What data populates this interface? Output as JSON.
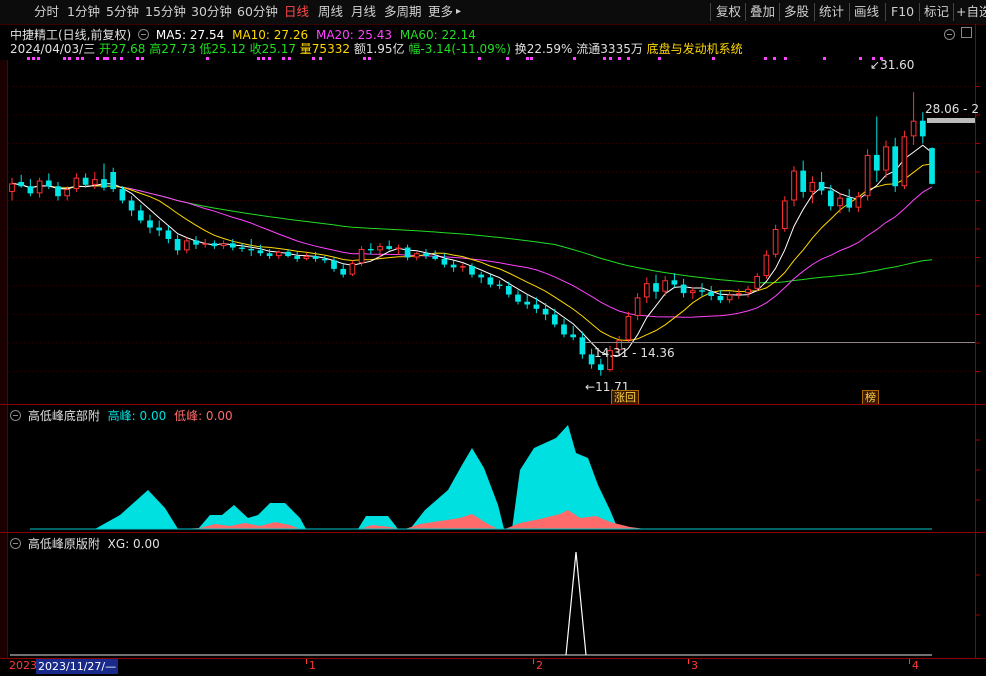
{
  "toolbar": {
    "periods": [
      "分时",
      "1分钟",
      "5分钟",
      "15分钟",
      "30分钟",
      "60分钟",
      "日线",
      "周线",
      "月线",
      "多周期",
      "更多"
    ],
    "active_period": "日线",
    "more_arrow": "▸",
    "right_buttons": [
      "复权",
      "叠加",
      "多股",
      "统计",
      "画线",
      "F10",
      "标记",
      "+自选"
    ]
  },
  "header": {
    "title": "中捷精工(日线,前复权)",
    "ma5": "MA5: 27.54",
    "ma10": "MA10: 27.26",
    "ma20": "MA20: 25.43",
    "ma60": "MA60: 22.14",
    "date": "2024/04/03/三",
    "open": "开27.68",
    "high": "高27.73",
    "low": "低25.12",
    "close": "收25.17",
    "volume": "量75332",
    "amount": "额1.95亿",
    "change": "幅-3.14(-11.09%)",
    "turnover": "换22.59%",
    "float": "流通3335万",
    "system_name": "底盘与发动机系统"
  },
  "price_chart": {
    "labels": {
      "high_mark": "31.60",
      "low_mark": "11.71",
      "range_mark": "14.31 - 14.36",
      "right_price": "28.06 - 2"
    },
    "badges": [
      "涨回",
      "榜"
    ],
    "colors": {
      "up": "#ff3232",
      "down": "#00e5e5",
      "ma5": "#ffffff",
      "ma10": "#ffd800",
      "ma20": "#ff44ff",
      "ma60": "#22dd22"
    }
  },
  "indicator1": {
    "name": "高低峰底部附",
    "high_label": "高峰: 0.00",
    "low_label": "低峰: 0.00"
  },
  "indicator2": {
    "name": "高低峰原版附",
    "xg_label": "XG: 0.00"
  },
  "time_axis": {
    "year": "2023",
    "cursor_date": "2023/11/27/—",
    "months": [
      "1",
      "2",
      "3",
      "4"
    ]
  },
  "chart_data": {
    "type": "candlestick",
    "title": "中捷精工(日线,前复权)",
    "ylim": [
      10,
      34
    ],
    "note_high": 31.6,
    "note_low": 11.71,
    "candles": [
      {
        "o": 24.6,
        "h": 25.6,
        "l": 24.0,
        "c": 25.2
      },
      {
        "o": 25.3,
        "h": 25.8,
        "l": 24.9,
        "c": 25.0
      },
      {
        "o": 25.0,
        "h": 25.5,
        "l": 24.3,
        "c": 24.5
      },
      {
        "o": 24.5,
        "h": 25.6,
        "l": 24.2,
        "c": 25.4
      },
      {
        "o": 25.4,
        "h": 25.9,
        "l": 24.8,
        "c": 25.0
      },
      {
        "o": 25.0,
        "h": 25.3,
        "l": 24.0,
        "c": 24.3
      },
      {
        "o": 24.3,
        "h": 25.0,
        "l": 24.0,
        "c": 24.8
      },
      {
        "o": 24.8,
        "h": 25.9,
        "l": 24.6,
        "c": 25.6
      },
      {
        "o": 25.6,
        "h": 25.9,
        "l": 24.9,
        "c": 25.1
      },
      {
        "o": 25.1,
        "h": 26.0,
        "l": 24.8,
        "c": 25.5
      },
      {
        "o": 25.5,
        "h": 26.6,
        "l": 24.7,
        "c": 24.9
      },
      {
        "o": 26.0,
        "h": 26.3,
        "l": 24.6,
        "c": 24.8
      },
      {
        "o": 24.8,
        "h": 25.0,
        "l": 23.8,
        "c": 24.0
      },
      {
        "o": 24.0,
        "h": 24.3,
        "l": 22.9,
        "c": 23.3
      },
      {
        "o": 23.3,
        "h": 23.7,
        "l": 22.4,
        "c": 22.6
      },
      {
        "o": 22.6,
        "h": 23.0,
        "l": 21.7,
        "c": 22.1
      },
      {
        "o": 22.1,
        "h": 22.6,
        "l": 21.5,
        "c": 21.9
      },
      {
        "o": 21.9,
        "h": 22.2,
        "l": 21.0,
        "c": 21.3
      },
      {
        "o": 21.3,
        "h": 21.6,
        "l": 20.2,
        "c": 20.5
      },
      {
        "o": 20.5,
        "h": 21.4,
        "l": 20.3,
        "c": 21.2
      },
      {
        "o": 21.2,
        "h": 21.5,
        "l": 20.6,
        "c": 20.9
      },
      {
        "o": 20.9,
        "h": 21.3,
        "l": 20.7,
        "c": 21.0
      },
      {
        "o": 21.0,
        "h": 21.2,
        "l": 20.6,
        "c": 20.8
      },
      {
        "o": 20.8,
        "h": 21.2,
        "l": 20.6,
        "c": 21.0
      },
      {
        "o": 21.0,
        "h": 21.3,
        "l": 20.5,
        "c": 20.7
      },
      {
        "o": 20.7,
        "h": 21.0,
        "l": 20.4,
        "c": 20.6
      },
      {
        "o": 20.6,
        "h": 21.3,
        "l": 20.1,
        "c": 20.5
      },
      {
        "o": 20.5,
        "h": 20.9,
        "l": 20.1,
        "c": 20.3
      },
      {
        "o": 20.3,
        "h": 20.6,
        "l": 19.9,
        "c": 20.1
      },
      {
        "o": 20.1,
        "h": 20.5,
        "l": 19.9,
        "c": 20.4
      },
      {
        "o": 20.4,
        "h": 20.6,
        "l": 20.0,
        "c": 20.1
      },
      {
        "o": 20.1,
        "h": 20.4,
        "l": 19.7,
        "c": 19.9
      },
      {
        "o": 19.9,
        "h": 20.3,
        "l": 19.8,
        "c": 20.1
      },
      {
        "o": 20.1,
        "h": 20.4,
        "l": 19.7,
        "c": 19.9
      },
      {
        "o": 19.9,
        "h": 20.1,
        "l": 19.6,
        "c": 19.8
      },
      {
        "o": 19.8,
        "h": 20.0,
        "l": 19.0,
        "c": 19.2
      },
      {
        "o": 19.2,
        "h": 19.5,
        "l": 18.6,
        "c": 18.8
      },
      {
        "o": 18.8,
        "h": 19.8,
        "l": 18.7,
        "c": 19.6
      },
      {
        "o": 19.6,
        "h": 20.8,
        "l": 19.4,
        "c": 20.6
      },
      {
        "o": 20.6,
        "h": 21.0,
        "l": 20.2,
        "c": 20.5
      },
      {
        "o": 20.5,
        "h": 21.0,
        "l": 20.0,
        "c": 20.8
      },
      {
        "o": 20.8,
        "h": 21.2,
        "l": 20.5,
        "c": 20.6
      },
      {
        "o": 20.6,
        "h": 20.9,
        "l": 20.2,
        "c": 20.7
      },
      {
        "o": 20.7,
        "h": 20.9,
        "l": 19.8,
        "c": 20.0
      },
      {
        "o": 20.0,
        "h": 20.4,
        "l": 19.8,
        "c": 20.3
      },
      {
        "o": 20.3,
        "h": 20.6,
        "l": 19.9,
        "c": 20.1
      },
      {
        "o": 20.1,
        "h": 20.5,
        "l": 19.8,
        "c": 19.9
      },
      {
        "o": 19.9,
        "h": 20.3,
        "l": 19.3,
        "c": 19.5
      },
      {
        "o": 19.5,
        "h": 19.8,
        "l": 19.0,
        "c": 19.3
      },
      {
        "o": 19.3,
        "h": 19.6,
        "l": 19.0,
        "c": 19.4
      },
      {
        "o": 19.4,
        "h": 19.6,
        "l": 18.6,
        "c": 18.8
      },
      {
        "o": 18.8,
        "h": 19.0,
        "l": 18.2,
        "c": 18.6
      },
      {
        "o": 18.6,
        "h": 18.8,
        "l": 17.9,
        "c": 18.1
      },
      {
        "o": 18.1,
        "h": 18.4,
        "l": 17.8,
        "c": 18.0
      },
      {
        "o": 18.0,
        "h": 18.3,
        "l": 17.2,
        "c": 17.4
      },
      {
        "o": 17.4,
        "h": 17.7,
        "l": 16.7,
        "c": 16.9
      },
      {
        "o": 16.9,
        "h": 17.4,
        "l": 16.4,
        "c": 16.7
      },
      {
        "o": 16.7,
        "h": 17.2,
        "l": 16.1,
        "c": 16.4
      },
      {
        "o": 16.4,
        "h": 16.8,
        "l": 15.6,
        "c": 16.0
      },
      {
        "o": 16.0,
        "h": 16.4,
        "l": 15.1,
        "c": 15.3
      },
      {
        "o": 15.3,
        "h": 15.7,
        "l": 14.4,
        "c": 14.6
      },
      {
        "o": 14.6,
        "h": 15.2,
        "l": 14.2,
        "c": 14.4
      },
      {
        "o": 14.4,
        "h": 14.8,
        "l": 12.9,
        "c": 13.2
      },
      {
        "o": 13.2,
        "h": 13.6,
        "l": 12.2,
        "c": 12.5
      },
      {
        "o": 12.5,
        "h": 12.9,
        "l": 11.71,
        "c": 12.1
      },
      {
        "o": 12.1,
        "h": 13.8,
        "l": 12.0,
        "c": 13.5
      },
      {
        "o": 13.5,
        "h": 14.5,
        "l": 13.3,
        "c": 14.2
      },
      {
        "o": 14.2,
        "h": 16.2,
        "l": 14.0,
        "c": 15.9
      },
      {
        "o": 15.9,
        "h": 17.5,
        "l": 15.6,
        "c": 17.2
      },
      {
        "o": 17.2,
        "h": 18.6,
        "l": 16.8,
        "c": 18.2
      },
      {
        "o": 18.2,
        "h": 18.8,
        "l": 17.1,
        "c": 17.6
      },
      {
        "o": 17.6,
        "h": 18.7,
        "l": 17.3,
        "c": 18.4
      },
      {
        "o": 18.4,
        "h": 18.9,
        "l": 17.9,
        "c": 18.1
      },
      {
        "o": 18.1,
        "h": 18.5,
        "l": 17.2,
        "c": 17.5
      },
      {
        "o": 17.5,
        "h": 17.9,
        "l": 17.1,
        "c": 17.7
      },
      {
        "o": 17.7,
        "h": 18.2,
        "l": 17.3,
        "c": 17.6
      },
      {
        "o": 17.6,
        "h": 18.0,
        "l": 17.0,
        "c": 17.3
      },
      {
        "o": 17.3,
        "h": 17.7,
        "l": 16.8,
        "c": 17.0
      },
      {
        "o": 17.0,
        "h": 17.6,
        "l": 16.8,
        "c": 17.4
      },
      {
        "o": 17.4,
        "h": 17.8,
        "l": 17.1,
        "c": 17.5
      },
      {
        "o": 17.5,
        "h": 18.0,
        "l": 17.2,
        "c": 17.8
      },
      {
        "o": 17.8,
        "h": 18.9,
        "l": 17.6,
        "c": 18.7
      },
      {
        "o": 18.7,
        "h": 20.5,
        "l": 18.5,
        "c": 20.2
      },
      {
        "o": 20.2,
        "h": 22.3,
        "l": 20.0,
        "c": 22.0
      },
      {
        "o": 22.0,
        "h": 24.3,
        "l": 21.8,
        "c": 24.0
      },
      {
        "o": 24.0,
        "h": 26.4,
        "l": 23.6,
        "c": 26.1
      },
      {
        "o": 26.1,
        "h": 26.8,
        "l": 24.2,
        "c": 24.6
      },
      {
        "o": 24.6,
        "h": 25.7,
        "l": 23.8,
        "c": 25.3
      },
      {
        "o": 25.3,
        "h": 26.0,
        "l": 24.4,
        "c": 24.7
      },
      {
        "o": 24.7,
        "h": 25.1,
        "l": 23.3,
        "c": 23.6
      },
      {
        "o": 23.6,
        "h": 24.5,
        "l": 23.1,
        "c": 24.2
      },
      {
        "o": 24.2,
        "h": 24.8,
        "l": 23.2,
        "c": 23.5
      },
      {
        "o": 23.5,
        "h": 24.6,
        "l": 23.2,
        "c": 24.3
      },
      {
        "o": 24.3,
        "h": 27.6,
        "l": 24.0,
        "c": 27.2
      },
      {
        "o": 27.2,
        "h": 29.9,
        "l": 25.3,
        "c": 26.1
      },
      {
        "o": 26.1,
        "h": 28.2,
        "l": 25.6,
        "c": 27.8
      },
      {
        "o": 27.8,
        "h": 28.4,
        "l": 24.6,
        "c": 25.0
      },
      {
        "o": 25.0,
        "h": 28.9,
        "l": 24.8,
        "c": 28.5
      },
      {
        "o": 28.5,
        "h": 31.6,
        "l": 27.9,
        "c": 29.6
      },
      {
        "o": 29.6,
        "h": 30.2,
        "l": 28.0,
        "c": 28.5
      },
      {
        "o": 27.68,
        "h": 27.73,
        "l": 25.12,
        "c": 25.17
      }
    ],
    "indicator1": {
      "series": [
        {
          "name": "高峰",
          "color": "#00e0e0"
        },
        {
          "name": "低峰",
          "color": "#ff6a6a"
        }
      ]
    }
  }
}
